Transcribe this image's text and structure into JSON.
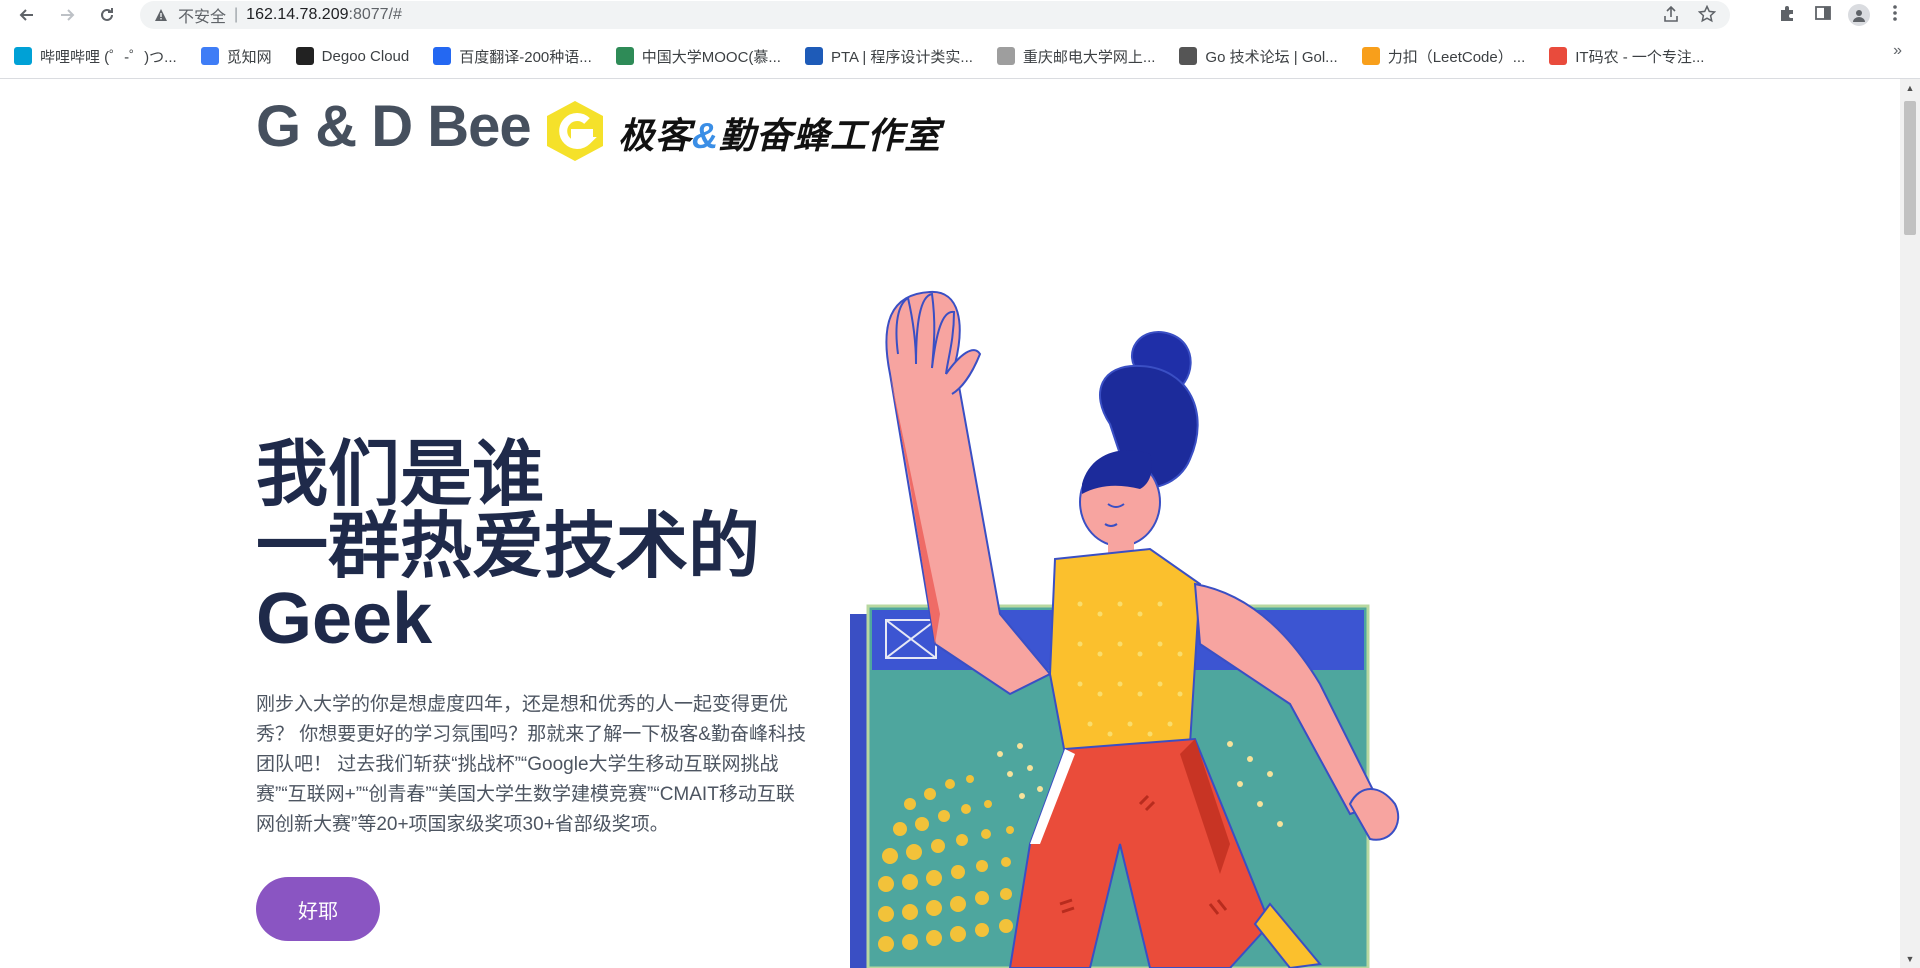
{
  "browser": {
    "security_label": "不安全",
    "url_host": "162.14.78.209",
    "url_rest": ":8077/#",
    "bookmarks": [
      {
        "label": "哔哩哔哩 (゜-゜)つ...",
        "color": "#00a1d6"
      },
      {
        "label": "觅知网",
        "color": "#3f7df6"
      },
      {
        "label": "Degoo Cloud",
        "color": "#222222"
      },
      {
        "label": "百度翻译-200种语...",
        "color": "#2468f2"
      },
      {
        "label": "中国大学MOOC(慕...",
        "color": "#2e8b57"
      },
      {
        "label": "PTA | 程序设计类实...",
        "color": "#1e5bb8"
      },
      {
        "label": "重庆邮电大学网上...",
        "color": "#9e9e9e"
      },
      {
        "label": "Go 技术论坛 | Gol...",
        "color": "#555555"
      },
      {
        "label": "力扣（LeetCode）...",
        "color": "#f89f1b"
      },
      {
        "label": "IT码农 - 一个专注...",
        "color": "#e94b3c"
      }
    ],
    "more_label": "»"
  },
  "header": {
    "brand": "G & D Bee",
    "brand_cn_part1": "极客",
    "brand_cn_amp": "&",
    "brand_cn_part2": "勤奋蜂工作室",
    "logo_color": "#f5e12a"
  },
  "hero": {
    "title_line1": "我们是谁",
    "title_line2": "一群热爱技术的",
    "title_line3": "Geek",
    "description": "刚步入大学的你是想虚度四年，还是想和优秀的人一起变得更优秀？ 你想要更好的学习氛围吗？那就来了解一下极客&勤奋峰科技团队吧！ 过去我们斩获“挑战杯”“Google大学生移动互联网挑战赛”“互联网+”“创青春”“美国大学生数学建模竞赛”“CMAIT移动互联网创新大赛”等20+项国家级奖项30+省部级奖项。",
    "cta_label": "好耶",
    "cta_color": "#8a55c2",
    "title_color": "#1f2a4a"
  }
}
